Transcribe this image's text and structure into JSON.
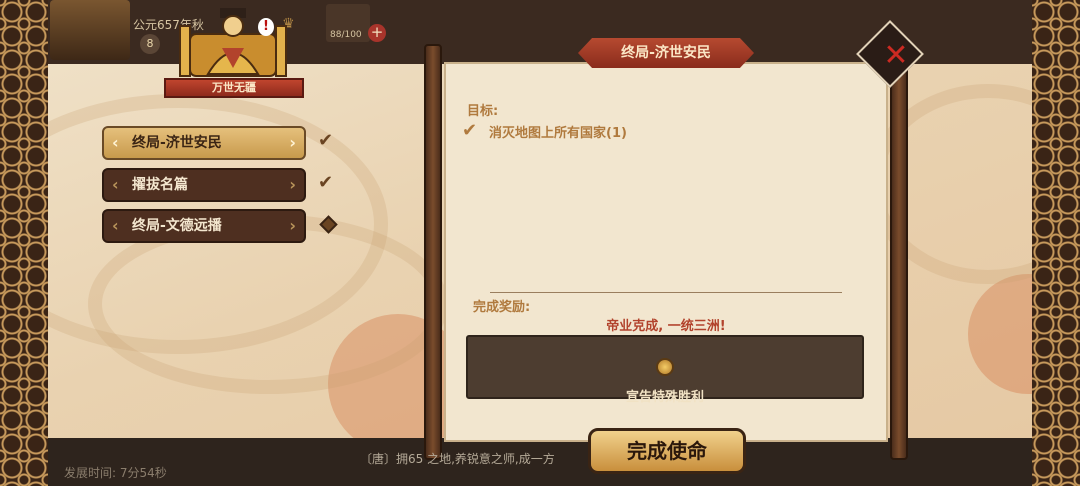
{
  "hud": {
    "year": "公元657年秋",
    "level": "8",
    "troops": "88/100",
    "plus_icon": "plus-icon",
    "crown_icon": "crown-icon"
  },
  "emperor": {
    "title": "万世无疆",
    "alert": "!"
  },
  "missions": [
    {
      "label": "终局-济世安民",
      "status": "check",
      "active": true
    },
    {
      "label": "擢拔名篇",
      "status": "check",
      "active": false
    },
    {
      "label": "终局-文德远播",
      "status": "diamond",
      "active": false
    }
  ],
  "status_glyphs": {
    "check": "✔"
  },
  "panel": {
    "header": "终局-济世安民",
    "goal_label": "目标:",
    "goal_text": "消灭地图上所有国家(1)",
    "reward_label": "完成奖励:",
    "reward_desc": "帝业克成, 一统三洲!",
    "reward_text": "宣告特殊胜利"
  },
  "buttons": {
    "complete": "完成使命",
    "close": "✕"
  },
  "footer": {
    "dev_time": "发展时间: 7分54秒",
    "chat": "〔唐〕拥65 之地,养锐意之师,成一方"
  },
  "colors": {
    "accent_red": "#b64a30",
    "panel_bg": "#f2e6cf",
    "text_brown": "#b07a3e"
  }
}
